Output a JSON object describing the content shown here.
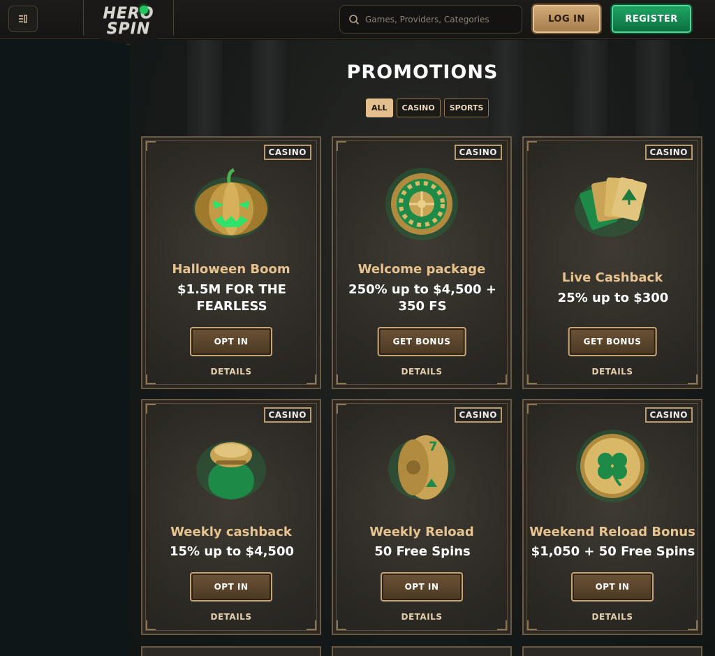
{
  "header": {
    "logo_line1": "HERO",
    "logo_line2": "SPIN",
    "search_placeholder": "Games, Providers, Categories",
    "login_label": "LOG IN",
    "register_label": "REGISTER"
  },
  "page": {
    "title": "PROMOTIONS",
    "filters": [
      "ALL",
      "CASINO",
      "SPORTS"
    ],
    "active_filter": "ALL"
  },
  "colors": {
    "gold": "#e7c48f",
    "green": "#1fa866",
    "card_bg": "#2e2b26"
  },
  "promotions": [
    {
      "badge": "CASINO",
      "name": "Halloween Boom",
      "offer": "$1.5M FOR THE FEARLESS",
      "cta": "OPT IN",
      "details": "DETAILS",
      "icon": "pumpkin-icon"
    },
    {
      "badge": "CASINO",
      "name": "Welcome package",
      "offer": "250% up to $4,500 + 350 FS",
      "cta": "GET BONUS",
      "details": "DETAILS",
      "icon": "roulette-icon"
    },
    {
      "badge": "CASINO",
      "name": "Live Cashback",
      "offer": "25% up to $300",
      "cta": "GET BONUS",
      "details": "DETAILS",
      "icon": "cards-icon"
    },
    {
      "badge": "CASINO",
      "name": "Weekly cashback",
      "offer": "15% up to $4,500",
      "cta": "OPT IN",
      "details": "DETAILS",
      "icon": "money-bag-icon"
    },
    {
      "badge": "CASINO",
      "name": "Weekly Reload",
      "offer": "50 Free Spins",
      "cta": "OPT IN",
      "details": "DETAILS",
      "icon": "slot-reel-icon"
    },
    {
      "badge": "CASINO",
      "name": "Weekend Reload Bonus",
      "offer": "$1,050 + 50 Free Spins",
      "cta": "OPT IN",
      "details": "DETAILS",
      "icon": "clover-coin-icon"
    }
  ]
}
